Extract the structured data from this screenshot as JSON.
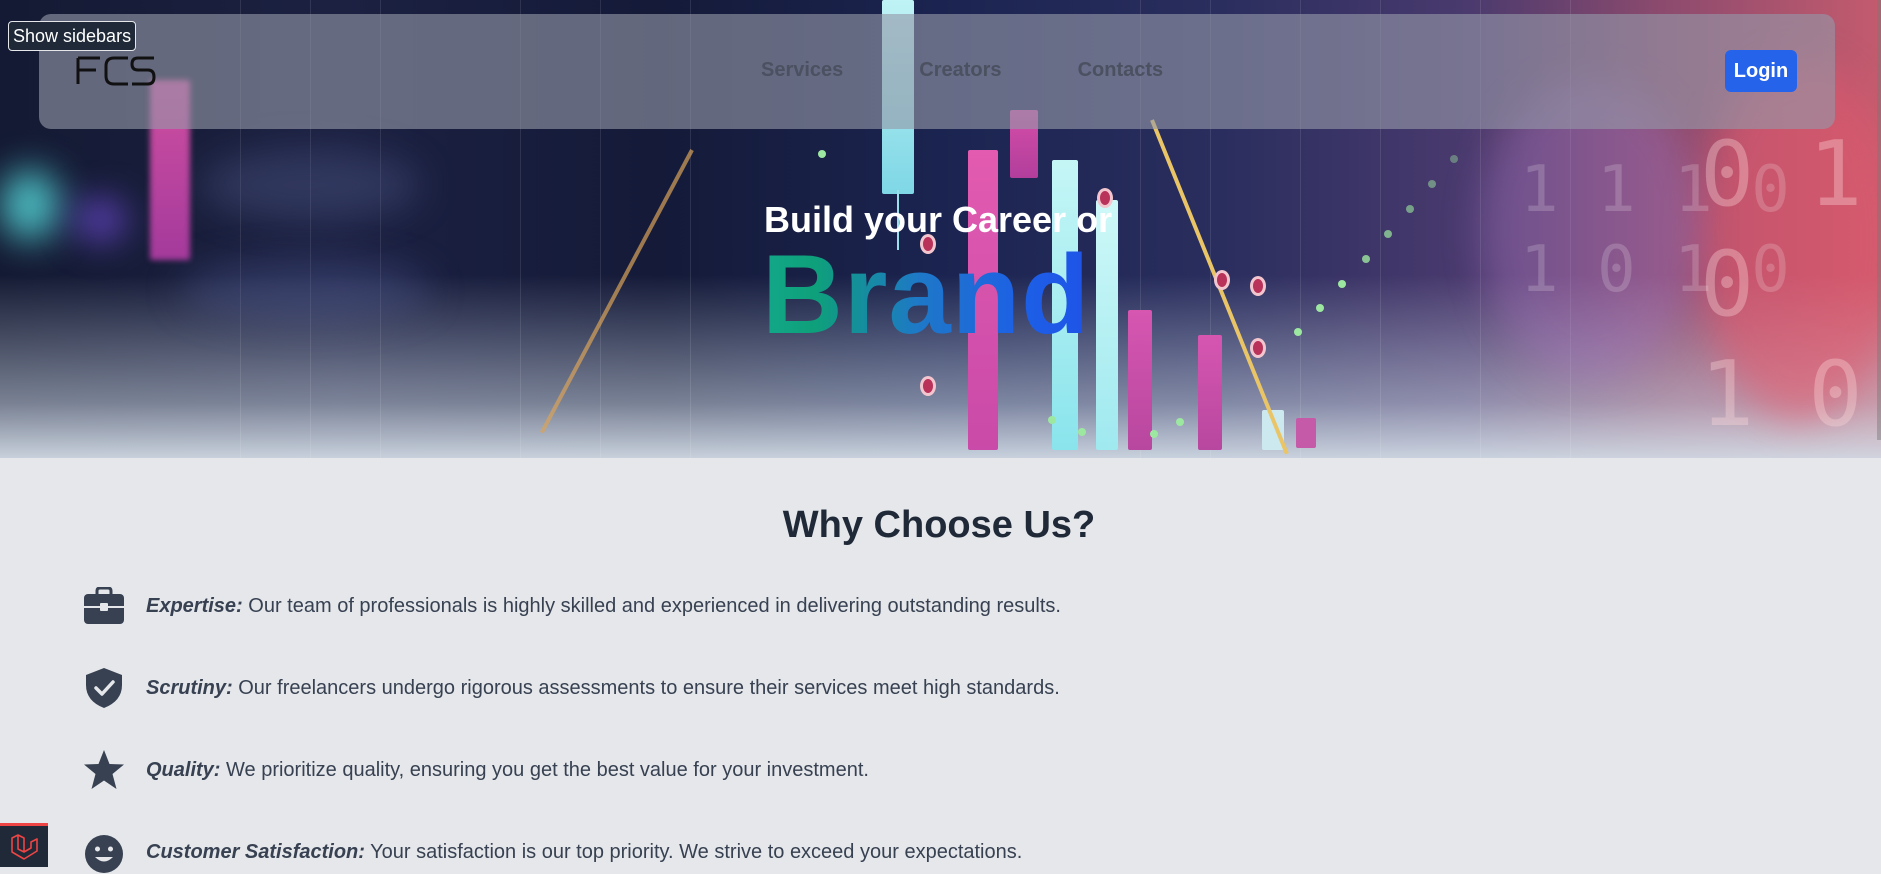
{
  "debug": {
    "show_sidebars_label": "Show sidebars"
  },
  "nav": {
    "logo_text": "FCS",
    "links": [
      {
        "label": "Services"
      },
      {
        "label": "Creators"
      },
      {
        "label": "Contacts"
      }
    ],
    "login_label": "Login"
  },
  "hero": {
    "line1": "Build your Career or",
    "line2": "Brand"
  },
  "why": {
    "title": "Why Choose Us?",
    "features": [
      {
        "icon": "briefcase-icon",
        "label": "Expertise:",
        "text": " Our team of professionals is highly skilled and experienced in delivering outstanding results."
      },
      {
        "icon": "shield-check-icon",
        "label": "Scrutiny:",
        "text": " Our freelancers undergo rigorous assessments to ensure their services meet high standards."
      },
      {
        "icon": "star-icon",
        "label": "Quality:",
        "text": " We prioritize quality, ensuring you get the best value for your investment."
      },
      {
        "icon": "smile-icon",
        "label": "Customer Satisfaction:",
        "text": " Your satisfaction is our top priority. We strive to exceed your expectations."
      }
    ]
  },
  "colors": {
    "accent": "#2563eb",
    "text_dark": "#1f2937",
    "section_bg": "#e5e7eb",
    "icon_color": "#374151",
    "brand_gradient_start": "#13a88a",
    "brand_gradient_end": "#1f4fe8"
  }
}
